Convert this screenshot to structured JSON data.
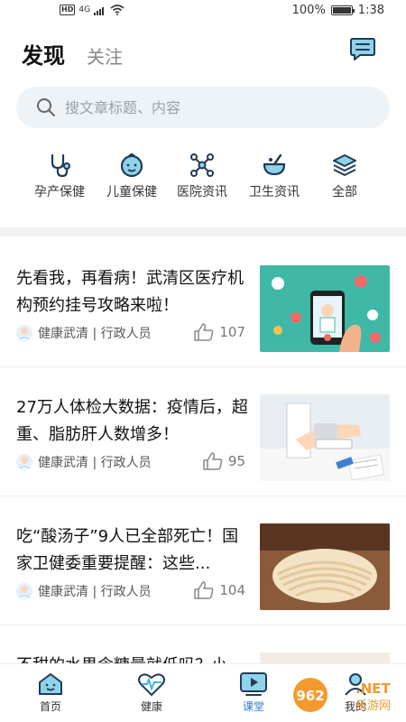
{
  "status_bar": {
    "hd": "HD",
    "network": "4G",
    "battery_text": "100%",
    "battery_level": 1.0,
    "time": "1:38"
  },
  "header": {
    "tab_active": "发现",
    "tab_inactive": "关注",
    "message_icon": "message-icon"
  },
  "search": {
    "placeholder": "搜文章标题、内容"
  },
  "categories": [
    {
      "label": "孕产保健",
      "icon": "stethoscope-icon"
    },
    {
      "label": "儿童保健",
      "icon": "baby-icon"
    },
    {
      "label": "医院资讯",
      "icon": "network-icon"
    },
    {
      "label": "卫生资讯",
      "icon": "mortar-icon"
    },
    {
      "label": "全部",
      "icon": "layers-icon"
    }
  ],
  "articles": [
    {
      "title": "先看我，再看病！武清区医疗机构预约挂号攻略来啦！",
      "author": "健康武清 | 行政人员",
      "likes": "107"
    },
    {
      "title": "27万人体检大数据：疫情后，超重、脂肪肝人数增多！",
      "author": "健康武清 | 行政人员",
      "likes": "95"
    },
    {
      "title": "吃“酸汤子”9人已全部死亡！国家卫健委重要提醒：这些...",
      "author": "健康武清 | 行政人员",
      "likes": "104"
    },
    {
      "title": "不甜的水果含糖量就低吗？小",
      "author": "",
      "likes": ""
    }
  ],
  "bottom_nav": [
    {
      "label": "首页",
      "icon": "home-icon"
    },
    {
      "label": "健康",
      "icon": "heartbeat-icon"
    },
    {
      "label": "课堂",
      "icon": "video-icon"
    },
    {
      "label": "我的",
      "icon": "user-icon"
    }
  ],
  "watermark": {
    "brand": "962",
    "suffix": ".NET",
    "sub": "乐游网"
  },
  "colors": {
    "accent": "#2a7dd1",
    "icon_dark": "#1f3b57",
    "search_bg": "#eef3f7"
  }
}
